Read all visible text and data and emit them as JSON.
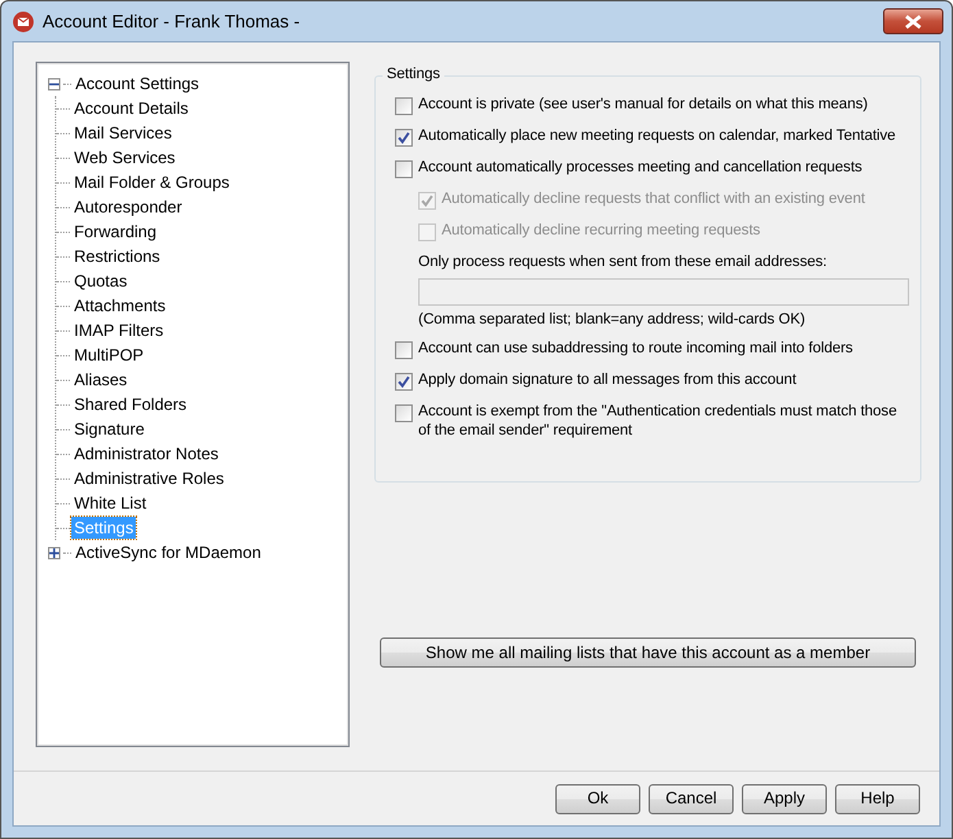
{
  "window": {
    "title": "Account Editor - Frank Thomas -"
  },
  "tree": [
    {
      "label": "Account Settings",
      "expanded": true,
      "selected": false,
      "children": [
        {
          "label": "Account Details",
          "selected": false
        },
        {
          "label": "Mail Services",
          "selected": false
        },
        {
          "label": "Web Services",
          "selected": false
        },
        {
          "label": "Mail Folder & Groups",
          "selected": false
        },
        {
          "label": "Autoresponder",
          "selected": false
        },
        {
          "label": "Forwarding",
          "selected": false
        },
        {
          "label": "Restrictions",
          "selected": false
        },
        {
          "label": "Quotas",
          "selected": false
        },
        {
          "label": "Attachments",
          "selected": false
        },
        {
          "label": "IMAP Filters",
          "selected": false
        },
        {
          "label": "MultiPOP",
          "selected": false
        },
        {
          "label": "Aliases",
          "selected": false
        },
        {
          "label": "Shared Folders",
          "selected": false
        },
        {
          "label": "Signature",
          "selected": false
        },
        {
          "label": "Administrator Notes",
          "selected": false
        },
        {
          "label": "Administrative Roles",
          "selected": false
        },
        {
          "label": "White List",
          "selected": false
        },
        {
          "label": "Settings",
          "selected": true
        }
      ]
    },
    {
      "label": "ActiveSync for MDaemon",
      "expanded": false,
      "selected": false
    }
  ],
  "settings": {
    "title": "Settings",
    "items": [
      {
        "kind": "checkbox",
        "label": "Account is private (see user's manual for details on what this means)",
        "checked": false,
        "disabled": false
      },
      {
        "kind": "checkbox",
        "label": "Automatically place new meeting requests on calendar, marked Tentative",
        "checked": true,
        "disabled": false
      },
      {
        "kind": "checkbox",
        "label": "Account automatically processes meeting and cancellation requests",
        "checked": false,
        "disabled": false
      },
      {
        "kind": "subcheckbox",
        "label": "Automatically decline requests that conflict with an existing event",
        "checked": true,
        "disabled": true
      },
      {
        "kind": "subcheckbox",
        "label": "Automatically decline recurring meeting requests",
        "checked": false,
        "disabled": true
      },
      {
        "kind": "label",
        "label": "Only process requests when sent from these email addresses:"
      },
      {
        "kind": "field",
        "disabled": true
      },
      {
        "kind": "note",
        "label": "(Comma separated list; blank=any address; wild-cards OK)"
      },
      {
        "kind": "checkbox",
        "label": "Account can use subaddressing to route incoming mail into folders",
        "checked": false,
        "disabled": false
      },
      {
        "kind": "checkbox",
        "label": "Apply domain signature to all messages from this account",
        "checked": true,
        "disabled": false
      },
      {
        "kind": "checkbox",
        "label": "Account is exempt from the \"Authentication credentials must match those of the email sender\" requirement",
        "checked": false,
        "disabled": false
      }
    ]
  },
  "mailing_lists_button": "Show me all mailing lists that have this account as a member",
  "buttons": [
    "Ok",
    "Cancel",
    "Apply",
    "Help"
  ]
}
